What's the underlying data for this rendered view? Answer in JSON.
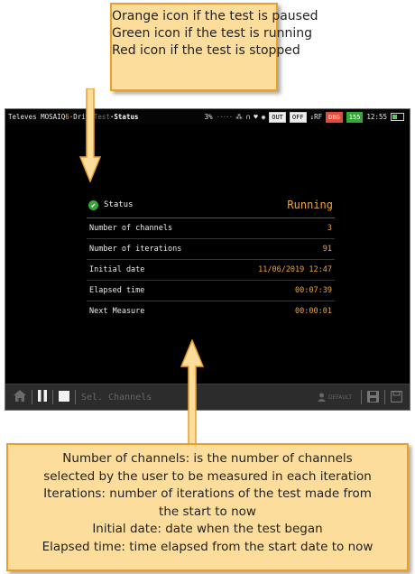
{
  "callouts": {
    "top": [
      "Orange icon if the test is paused",
      "Green icon if the test is running",
      "Red icon if the test is stopped"
    ],
    "bottom": [
      "Number of channels: is the number of channels",
      "selected by the user to be measured in each iteration",
      "Iterations: number of iterations of the test made from",
      "the start to now",
      "Initial date: date when the test began",
      "Elapsed time: time elapsed from the start date to now"
    ]
  },
  "statusbar": {
    "brand": "Televes MOSAIQ",
    "brand_q": "6",
    "path_mid": "·Drive",
    "path_hidden": "Test",
    "path_end": "·Status",
    "signal": "3%",
    "out_label": "OUT",
    "off_label": "OFF",
    "rf_label": "↓RF",
    "dbg_label": "DBG",
    "num_label": "155",
    "time": "12:55"
  },
  "status_panel": {
    "status_label": "Status",
    "status_value": "Running",
    "rows": [
      {
        "label": "Number of channels",
        "value": "3"
      },
      {
        "label": "Number of iterations",
        "value": "91"
      },
      {
        "label": "Initial date",
        "value": "11/06/2019 12:47"
      },
      {
        "label": "Elapsed time",
        "value": "00:07:39"
      },
      {
        "label": "Next Measure",
        "value": "00:00:01"
      }
    ]
  },
  "toolbar": {
    "sel_channels_label": "Sel. Channels",
    "default_label": "DEFAULT"
  },
  "colors": {
    "accent_orange": "#f2a531",
    "running_green": "#37a63a",
    "callout_fill": "#fcdd9c",
    "callout_border": "#e99f2c"
  },
  "icons": [
    "home-icon",
    "pause-icon",
    "stop-icon",
    "user-icon",
    "save-icon",
    "save-as-icon",
    "check-circle-icon"
  ]
}
